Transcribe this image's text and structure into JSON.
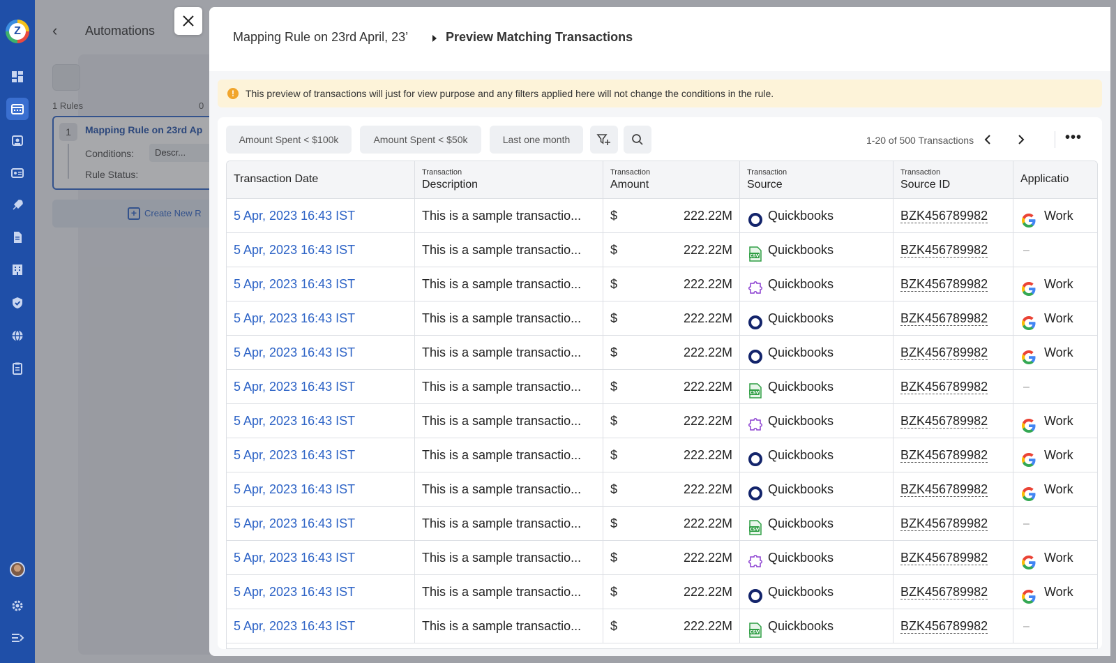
{
  "background": {
    "title": "Automations",
    "rules_count_label": "1 Rules",
    "rules_count_right": "0",
    "rule_number": "1",
    "rule_title": "Mapping Rule on 23rd Ap",
    "conditions_label": "Conditions:",
    "condition_chip": "Descr...",
    "rule_status_label": "Rule Status:",
    "create_label": "Create New R"
  },
  "modal": {
    "breadcrumb_parent": "Mapping Rule on 23rd April, 23’",
    "breadcrumb_current": "Preview Matching Transactions",
    "notice": "This preview of transactions will just for view purpose and any filters applied here will not change the conditions in the rule.",
    "filters": [
      "Amount Spent < $100k",
      "Amount Spent < $50k",
      "Last one month"
    ],
    "pager_text": "1-20 of 500 Transactions",
    "more_label": "•••"
  },
  "table": {
    "headers": {
      "date": "Transaction Date",
      "desc_small": "Transaction",
      "desc": "Description",
      "amount_small": "Transaction",
      "amount": "Amount",
      "source_small": "Transaction",
      "source": "Source",
      "sid_small": "Transaction",
      "sid": "Source ID",
      "app": "Applicatio"
    },
    "rows": [
      {
        "date": "5 Apr, 2023   16:43  IST",
        "desc": "This is a sample transactio...",
        "currency": "$",
        "amount": "222.22M",
        "source_icon": "circle-icon",
        "source": "Quickbooks",
        "source_id": "BZK456789982",
        "app_icon": "google-icon",
        "app": "Work"
      },
      {
        "date": "5 Apr, 2023   16:43  IST",
        "desc": "This is a sample transactio...",
        "currency": "$",
        "amount": "222.22M",
        "source_icon": "csv-icon",
        "source": "Quickbooks",
        "source_id": "BZK456789982",
        "app_icon": "",
        "app": "–"
      },
      {
        "date": "5 Apr, 2023   16:43  IST",
        "desc": "This is a sample transactio...",
        "currency": "$",
        "amount": "222.22M",
        "source_icon": "puzzle-icon",
        "source": "Quickbooks",
        "source_id": "BZK456789982",
        "app_icon": "google-icon",
        "app": "Work"
      },
      {
        "date": "5 Apr, 2023   16:43  IST",
        "desc": "This is a sample transactio...",
        "currency": "$",
        "amount": "222.22M",
        "source_icon": "circle-icon",
        "source": "Quickbooks",
        "source_id": "BZK456789982",
        "app_icon": "google-icon",
        "app": "Work"
      },
      {
        "date": "5 Apr, 2023   16:43  IST",
        "desc": "This is a sample transactio...",
        "currency": "$",
        "amount": "222.22M",
        "source_icon": "circle-icon",
        "source": "Quickbooks",
        "source_id": "BZK456789982",
        "app_icon": "google-icon",
        "app": "Work"
      },
      {
        "date": "5 Apr, 2023   16:43  IST",
        "desc": "This is a sample transactio...",
        "currency": "$",
        "amount": "222.22M",
        "source_icon": "csv-icon",
        "source": "Quickbooks",
        "source_id": "BZK456789982",
        "app_icon": "",
        "app": "–"
      },
      {
        "date": "5 Apr, 2023   16:43  IST",
        "desc": "This is a sample transactio...",
        "currency": "$",
        "amount": "222.22M",
        "source_icon": "puzzle-icon",
        "source": "Quickbooks",
        "source_id": "BZK456789982",
        "app_icon": "google-icon",
        "app": "Work"
      },
      {
        "date": "5 Apr, 2023   16:43  IST",
        "desc": "This is a sample transactio...",
        "currency": "$",
        "amount": "222.22M",
        "source_icon": "circle-icon",
        "source": "Quickbooks",
        "source_id": "BZK456789982",
        "app_icon": "google-icon",
        "app": "Work"
      },
      {
        "date": "5 Apr, 2023   16:43  IST",
        "desc": "This is a sample transactio...",
        "currency": "$",
        "amount": "222.22M",
        "source_icon": "circle-icon",
        "source": "Quickbooks",
        "source_id": "BZK456789982",
        "app_icon": "google-icon",
        "app": "Work"
      },
      {
        "date": "5 Apr, 2023   16:43  IST",
        "desc": "This is a sample transactio...",
        "currency": "$",
        "amount": "222.22M",
        "source_icon": "csv-icon",
        "source": "Quickbooks",
        "source_id": "BZK456789982",
        "app_icon": "",
        "app": "–"
      },
      {
        "date": "5 Apr, 2023   16:43  IST",
        "desc": "This is a sample transactio...",
        "currency": "$",
        "amount": "222.22M",
        "source_icon": "puzzle-icon",
        "source": "Quickbooks",
        "source_id": "BZK456789982",
        "app_icon": "google-icon",
        "app": "Work"
      },
      {
        "date": "5 Apr, 2023   16:43  IST",
        "desc": "This is a sample transactio...",
        "currency": "$",
        "amount": "222.22M",
        "source_icon": "circle-icon",
        "source": "Quickbooks",
        "source_id": "BZK456789982",
        "app_icon": "google-icon",
        "app": "Work"
      },
      {
        "date": "5 Apr, 2023   16:43  IST",
        "desc": "This is a sample transactio...",
        "currency": "$",
        "amount": "222.22M",
        "source_icon": "csv-icon",
        "source": "Quickbooks",
        "source_id": "BZK456789982",
        "app_icon": "",
        "app": "–"
      }
    ]
  },
  "colors": {
    "sidebar": "#1f4fa8",
    "link": "#2d63c6",
    "notice_bg": "#fdf3d9",
    "notice_icon": "#f1a52c"
  }
}
